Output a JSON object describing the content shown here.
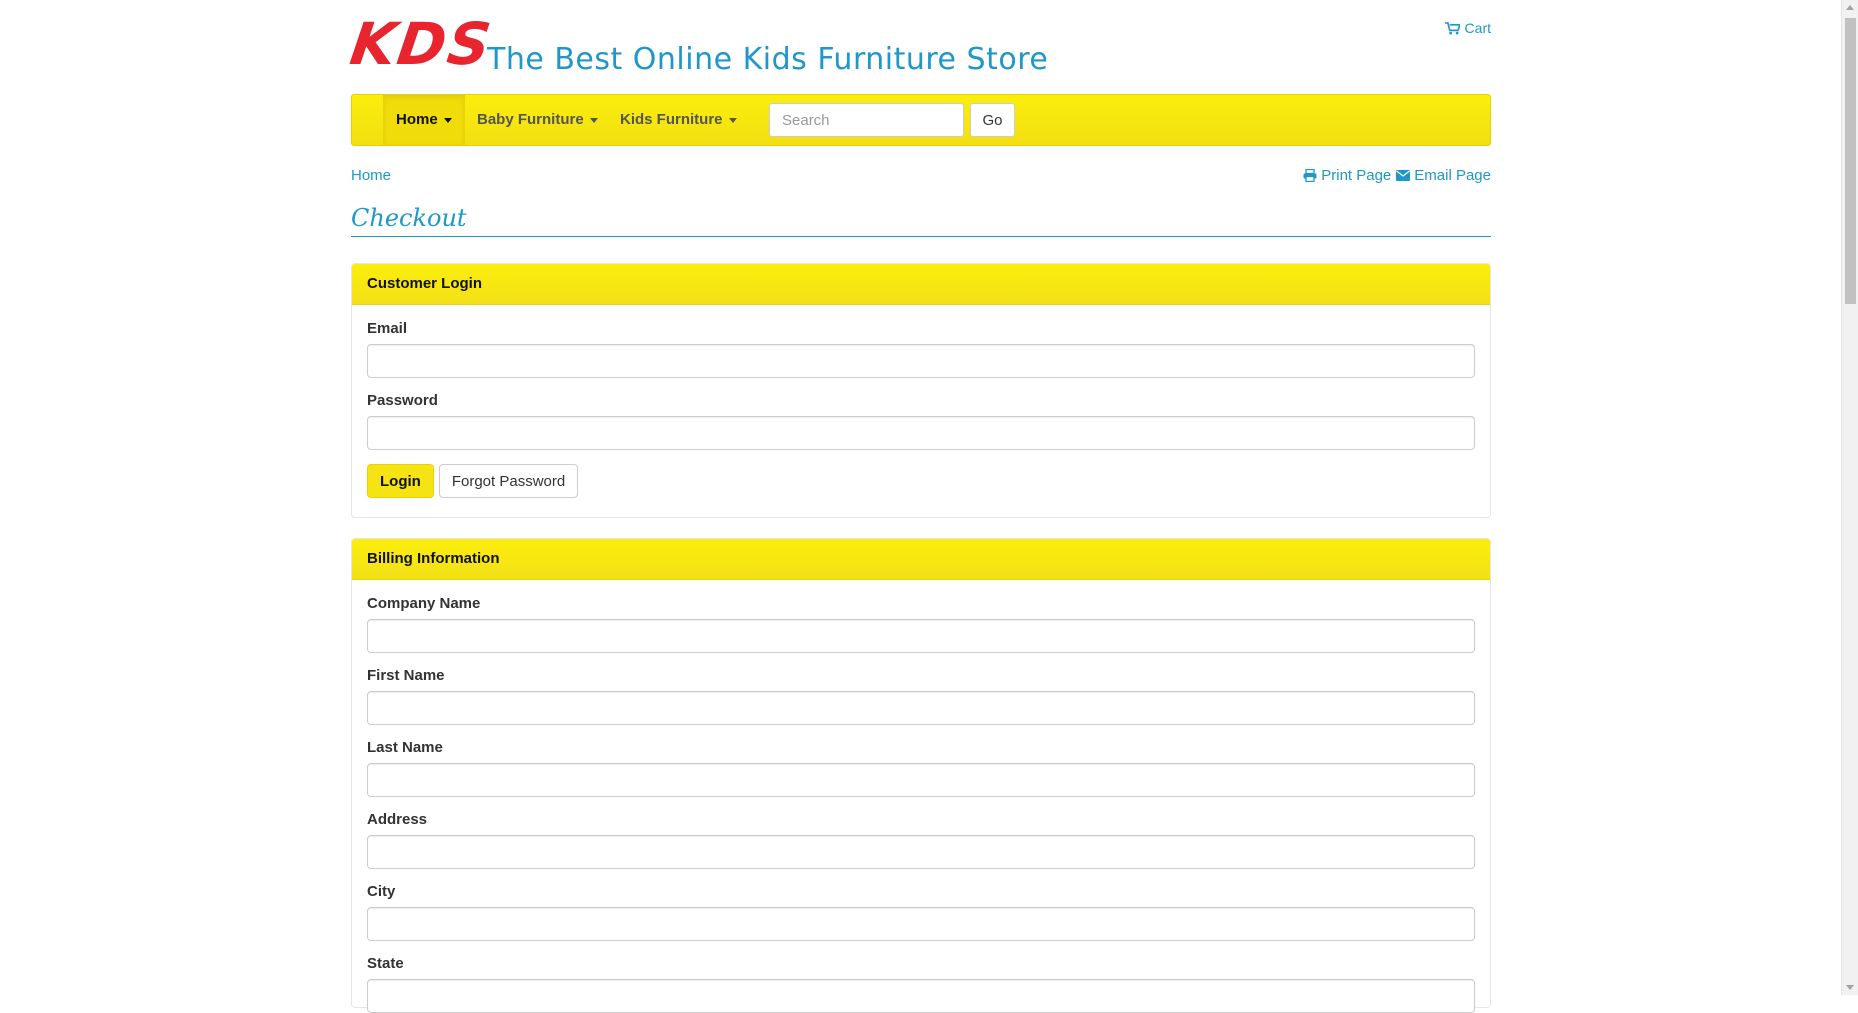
{
  "header": {
    "logo_text": "KDS",
    "tagline": "The Best Online Kids Furniture Store",
    "cart_label": "Cart"
  },
  "nav": {
    "items": [
      {
        "label": "Home"
      },
      {
        "label": "Baby Furniture"
      },
      {
        "label": "Kids Furniture"
      }
    ],
    "search_placeholder": "Search",
    "go_label": "Go"
  },
  "breadcrumb": {
    "home": "Home"
  },
  "utilities": {
    "print_label": "Print Page",
    "email_label": "Email Page"
  },
  "page_title": "Checkout",
  "login_panel": {
    "title": "Customer Login",
    "email_label": "Email",
    "password_label": "Password",
    "login_button": "Login",
    "forgot_button": "Forgot Password"
  },
  "billing_panel": {
    "title": "Billing Information",
    "fields": {
      "company": "Company Name",
      "first_name": "First Name",
      "last_name": "Last Name",
      "address": "Address",
      "city": "City",
      "state": "State"
    }
  },
  "colors": {
    "brand_red": "#e8242e",
    "link_blue": "#1f97c9",
    "accent_yellow": "#fbee0b"
  }
}
